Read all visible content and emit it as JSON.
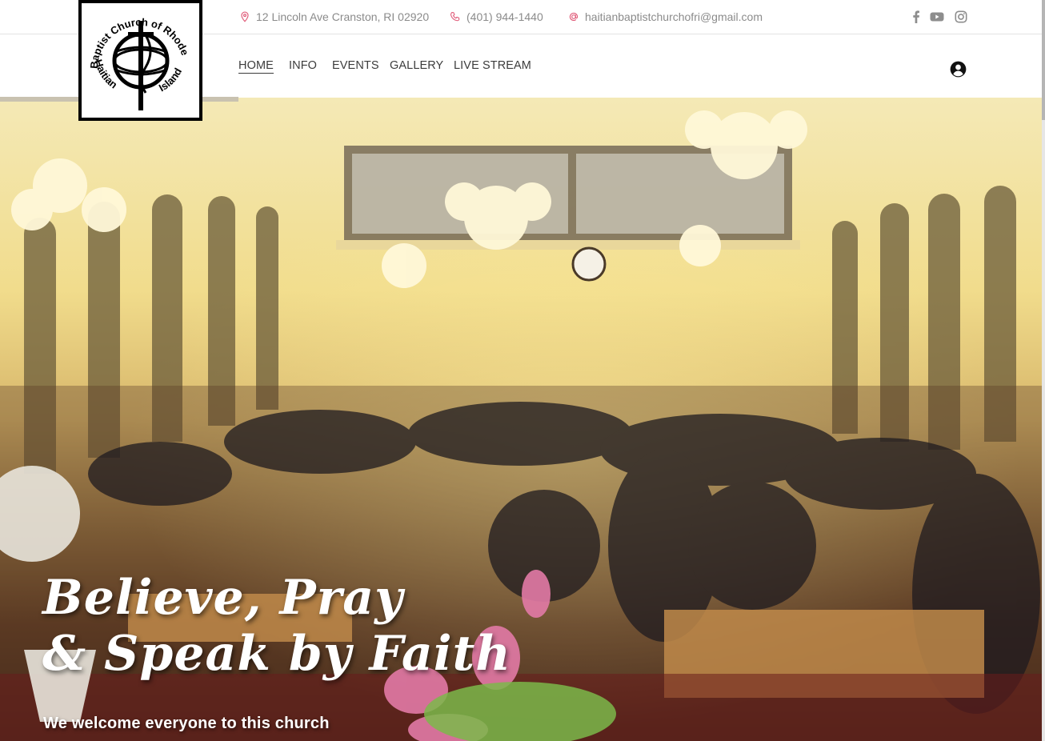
{
  "header": {
    "contacts": {
      "address": "12 Lincoln Ave Cranston, RI 02920",
      "phone": "(401) 944-1440",
      "email": "haitianbaptistchurchofri@gmail.com"
    },
    "social": [
      "facebook-icon",
      "youtube-icon",
      "instagram-icon"
    ],
    "icon_color": "#e05a78"
  },
  "logo": {
    "text": "Haitian Baptist Church of Rhode Island"
  },
  "nav": {
    "items": [
      {
        "label": "HOME",
        "active": true
      },
      {
        "label": "INFO",
        "active": false
      },
      {
        "label": "EVENTS",
        "active": false
      },
      {
        "label": "GALLERY",
        "active": false
      },
      {
        "label": "LIVE STREAM",
        "active": false
      }
    ],
    "account_icon": "user-circle-icon"
  },
  "hero": {
    "title_line1": "Believe, Pray",
    "title_line2": "& Speak by Faith",
    "subtitle": "We welcome everyone to this church",
    "image": "church-congregation-photo"
  }
}
